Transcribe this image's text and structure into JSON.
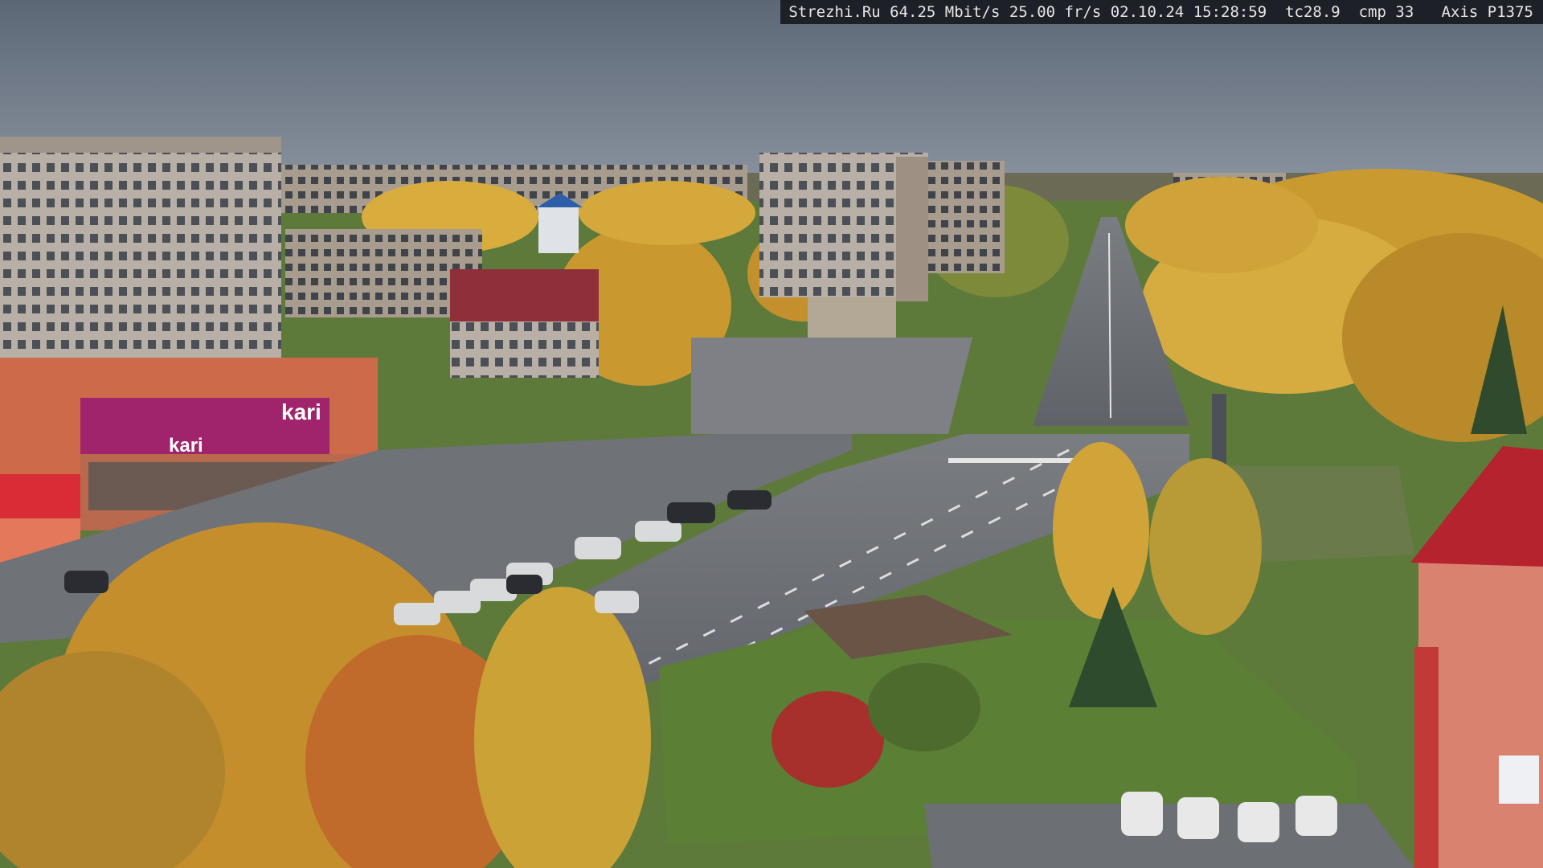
{
  "camera_overlay": {
    "site": "Strezhi.Ru",
    "bitrate": "64.25 Mbit/s",
    "framerate": "25.00 fr/s",
    "date": "02.10.24",
    "time": "15:28:59",
    "tc": "tc28.9",
    "cmp": "cmp 33",
    "camera_model": "Axis P1375"
  },
  "signs": {
    "store_logo": "kari",
    "store_banner_text": "kari"
  },
  "colors": {
    "sky": "#7d8794",
    "asphalt": "#6d7076",
    "foliage_yellow": "#d2a43a",
    "foliage_orange": "#c9842e",
    "grass": "#5b7f3a",
    "brick_red": "#b94c44",
    "store_magenta": "#a0246b"
  }
}
